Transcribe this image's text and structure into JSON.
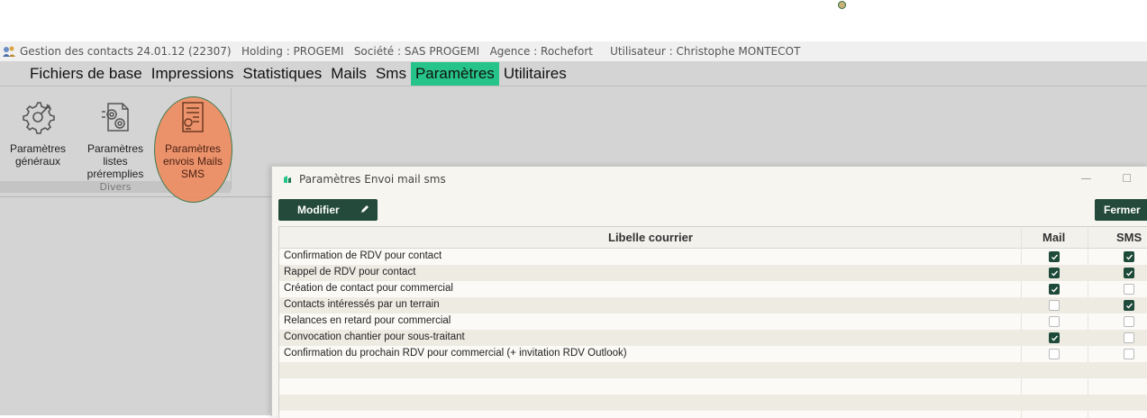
{
  "titlebar": {
    "app": "Gestion des contacts 24.01.12 (22307)",
    "holding": "Holding : PROGEMI",
    "societe": "Société : SAS PROGEMI",
    "agence": "Agence : Rochefort",
    "utilisateur": "Utilisateur : Christophe MONTECOT"
  },
  "menu": {
    "items": [
      "Fichiers de base",
      "Impressions",
      "Statistiques",
      "Mails",
      "Sms",
      "Paramètres",
      "Utilitaires"
    ],
    "active": "Paramètres",
    "active_color": "#26c48a"
  },
  "ribbon": {
    "group_label": "Divers",
    "buttons": [
      {
        "label": "Paramètres généraux",
        "icon": "gear-wrench-icon"
      },
      {
        "label": "Paramètres listes préremplies",
        "icon": "gears-document-icon"
      },
      {
        "label": "Paramètres envois Mails SMS",
        "icon": "mail-settings-document-icon"
      }
    ],
    "highlight_color": "#ee8c62"
  },
  "dialog": {
    "title": "Paramètres Envoi mail sms",
    "modifier_label": "Modifier",
    "fermer_label": "Fermer",
    "accent_color": "#234a3a",
    "columns": {
      "libelle": "Libelle courrier",
      "mail": "Mail",
      "sms": "SMS"
    },
    "rows": [
      {
        "libelle": "Confirmation de RDV pour contact",
        "mail": true,
        "sms": true
      },
      {
        "libelle": "Rappel de RDV pour contact",
        "mail": true,
        "sms": true
      },
      {
        "libelle": "Création de contact pour commercial",
        "mail": true,
        "sms": false
      },
      {
        "libelle": "Contacts intéressés par un terrain",
        "mail": false,
        "sms": true
      },
      {
        "libelle": "Relances en retard pour commercial",
        "mail": false,
        "sms": false
      },
      {
        "libelle": "Convocation chantier pour sous-traitant",
        "mail": true,
        "sms": false
      },
      {
        "libelle": "Confirmation du prochain RDV pour commercial (+ invitation RDV Outlook)",
        "mail": false,
        "sms": false
      }
    ]
  }
}
